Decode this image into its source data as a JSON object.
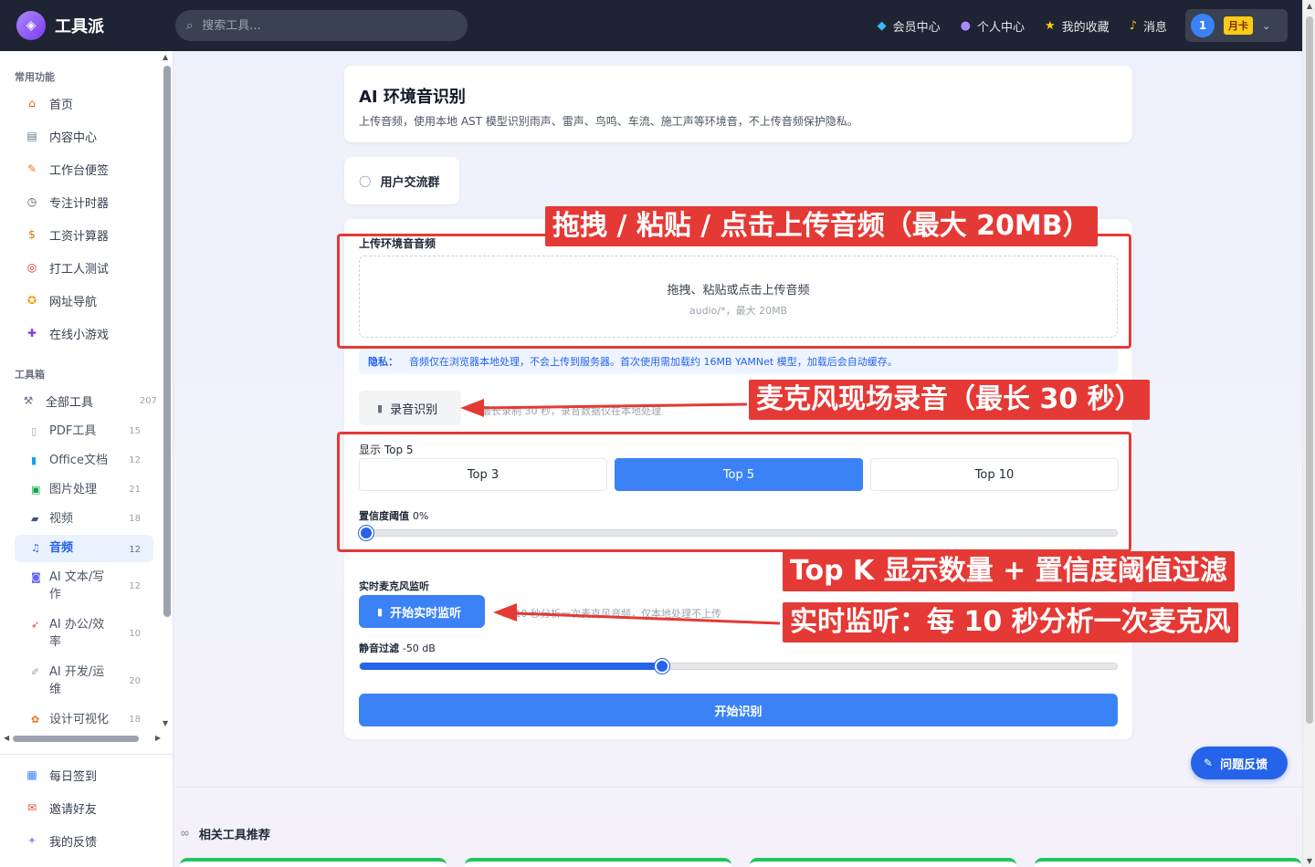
{
  "header": {
    "logo_text": "工具派",
    "search_placeholder": "搜索工具...",
    "nav": [
      "会员中心",
      "个人中心",
      "我的收藏",
      "消息"
    ],
    "user_number": "1",
    "vip_badge": "月卡"
  },
  "sidebar": {
    "section_common": "常用功能",
    "common_items": [
      "首页",
      "内容中心",
      "工作台便签",
      "专注计时器",
      "工资计算器",
      "打工人测试",
      "网址导航",
      "在线小游戏"
    ],
    "section_toolbox": "工具箱",
    "all_tools": {
      "label": "全部工具",
      "count": "207"
    },
    "tools": [
      {
        "label": "PDF工具",
        "count": "15"
      },
      {
        "label": "Office文档",
        "count": "12"
      },
      {
        "label": "图片处理",
        "count": "21"
      },
      {
        "label": "视频",
        "count": "18"
      },
      {
        "label": "音频",
        "count": "12"
      },
      {
        "label": "AI 文本/写作",
        "count": "12"
      },
      {
        "label": "AI 办公/效率",
        "count": "10"
      },
      {
        "label": "AI 开发/运维",
        "count": "20"
      },
      {
        "label": "设计可视化",
        "count": "18"
      }
    ],
    "bottom_items": [
      "每日签到",
      "邀请好友",
      "我的反馈"
    ]
  },
  "page": {
    "title": "AI 环境音识别",
    "subtitle": "上传音频，使用本地 AST 模型识别雨声、雷声、鸟鸣、车流、施工声等环境音，不上传音频保护隐私。",
    "group_button": "用户交流群"
  },
  "tool": {
    "upload_label": "上传环境音音频",
    "dropzone_main": "拖拽、粘贴或点击上传音频",
    "dropzone_sub": "audio/*，最大 20MB",
    "privacy_label": "隐私：",
    "privacy_text": "音频仅在浏览器本地处理，不会上传到服务器。首次使用需加载约 16MB YAMNet 模型，加载后会自动缓存。",
    "record_button": "录音识别",
    "record_hint": "最长录制 30 秒，录音数据仅在本地处理",
    "topk_label": "显示 Top 5",
    "topk_options": [
      "Top 3",
      "Top 5",
      "Top 10"
    ],
    "topk_selected": 5,
    "confidence_label": "置信度阈值",
    "confidence_value": "0%",
    "confidence_fraction": 0,
    "live_label": "实时麦克风监听",
    "live_button": "开始实时监听",
    "live_hint": "每 10 秒分析一次麦克风音频，仅本地处理不上传",
    "silence_label": "静音过滤",
    "silence_value": "-50 dB",
    "silence_fraction": 0.4,
    "start_button": "开始识别"
  },
  "related_title": "相关工具推荐",
  "feedback_button": "问题反馈",
  "annotations": {
    "upload": "拖拽 / 粘贴 / 点击上传音频（最大 20MB）",
    "record": "麦克风现场录音（最长 30 秒）",
    "topk": "Top K 显示数量 + 置信度阈值过滤",
    "live": "实时监听：每 10 秒分析一次麦克风"
  },
  "colors": {
    "accent": "#3b82f6",
    "annotation": "#e53935",
    "header": "#1e2433"
  }
}
